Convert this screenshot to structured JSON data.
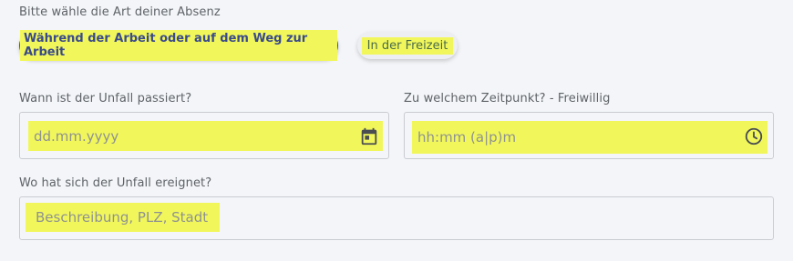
{
  "heading": "Bitte wähle die Art deiner Absenz",
  "absence_types": {
    "active_label": "Während der Arbeit oder auf dem Weg zur Arbeit",
    "inactive_label": "In der Freizeit"
  },
  "date_field": {
    "label": "Wann ist der Unfall passiert?",
    "placeholder": "dd.mm.yyyy",
    "icon": "calendar-icon"
  },
  "time_field": {
    "label": "Zu welchem Zeitpunkt? - Freiwillig",
    "placeholder": "hh:mm (a|p)m",
    "icon": "clock-icon"
  },
  "location_field": {
    "label": "Wo hat sich der Unfall ereignet?",
    "placeholder": "Beschreibung, PLZ, Stadt"
  },
  "colors": {
    "highlight": "#f1f75b",
    "active_gradient_start": "#2e6a6d",
    "active_gradient_end": "#3b6fae",
    "icon": "#4a4d52"
  }
}
